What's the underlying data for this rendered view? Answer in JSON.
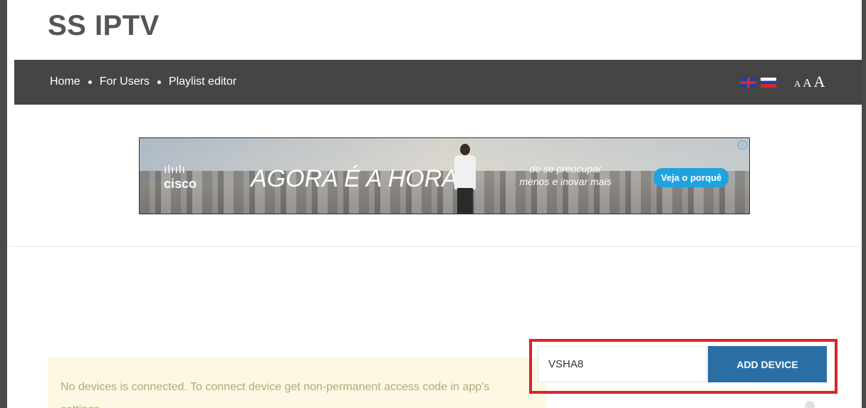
{
  "site": {
    "title": "SS IPTV"
  },
  "nav": {
    "links": [
      "Home",
      "For Users",
      "Playlist editor"
    ],
    "flags": [
      "uk-flag-icon",
      "ru-flag-icon"
    ],
    "font_sizes": [
      "A",
      "A",
      "A"
    ]
  },
  "ad": {
    "brand": "cisco",
    "logo_bars": "ılıılı",
    "headline": "AGORA É A HORA",
    "subtitle_line1": "de se preocupar",
    "subtitle_line2": "menos e inovar mais",
    "cta": "Veja o porquê",
    "info_icon": "i"
  },
  "device": {
    "code_value": "VSHA8",
    "add_button": "ADD DEVICE"
  },
  "notice": {
    "text": "No devices is connected. To connect device get non-permanent access code in app's settings"
  },
  "colors": {
    "navbar": "#454545",
    "button": "#2a6ea4",
    "highlight": "#d9242b",
    "notice_bg": "#fcf8e3",
    "notice_text": "#b5a77a"
  }
}
